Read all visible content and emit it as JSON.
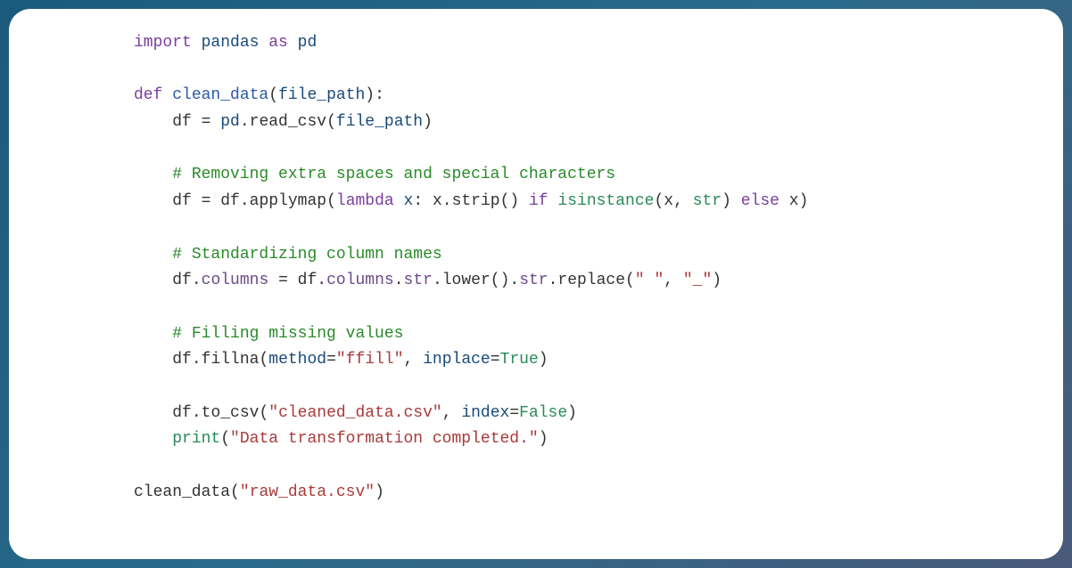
{
  "code": {
    "line1_import": "import",
    "line1_module": "pandas",
    "line1_as": "as",
    "line1_alias": "pd",
    "line3_def": "def",
    "line3_funcname": "clean_data",
    "line3_param": "file_path",
    "line4_var1": "df",
    "line4_eq": " = ",
    "line4_pd": "pd",
    "line4_method": "read_csv",
    "line4_arg": "file_path",
    "line6_comment": "# Removing extra spaces and special characters",
    "line7_var": "df",
    "line7_eq": " = ",
    "line7_df": "df",
    "line7_method": "applymap",
    "line7_lambda": "lambda",
    "line7_lvar": "x",
    "line7_lcolon": ": ",
    "line7_x1": "x",
    "line7_strip": "strip",
    "line7_if": "if",
    "line7_isinstance": "isinstance",
    "line7_x2": "x",
    "line7_str": "str",
    "line7_else": "else",
    "line7_x3": "x",
    "line9_comment": "# Standardizing column names",
    "line10_df": "df",
    "line10_columns1": "columns",
    "line10_eq": " = ",
    "line10_df2": "df",
    "line10_columns2": "columns",
    "line10_str": "str",
    "line10_lower": "lower",
    "line10_str2": "str",
    "line10_replace": "replace",
    "line10_arg1": "\" \"",
    "line10_arg2": "\"_\"",
    "line12_comment": "# Filling missing values",
    "line13_df": "df",
    "line13_fillna": "fillna",
    "line13_method_kw": "method",
    "line13_method_val": "\"ffill\"",
    "line13_inplace_kw": "inplace",
    "line13_inplace_val": "True",
    "line15_df": "df",
    "line15_tocsv": "to_csv",
    "line15_arg1": "\"cleaned_data.csv\"",
    "line15_index_kw": "index",
    "line15_index_val": "False",
    "line16_print": "print",
    "line16_arg": "\"Data transformation completed.\"",
    "line18_func": "clean_data",
    "line18_arg": "\"raw_data.csv\""
  }
}
